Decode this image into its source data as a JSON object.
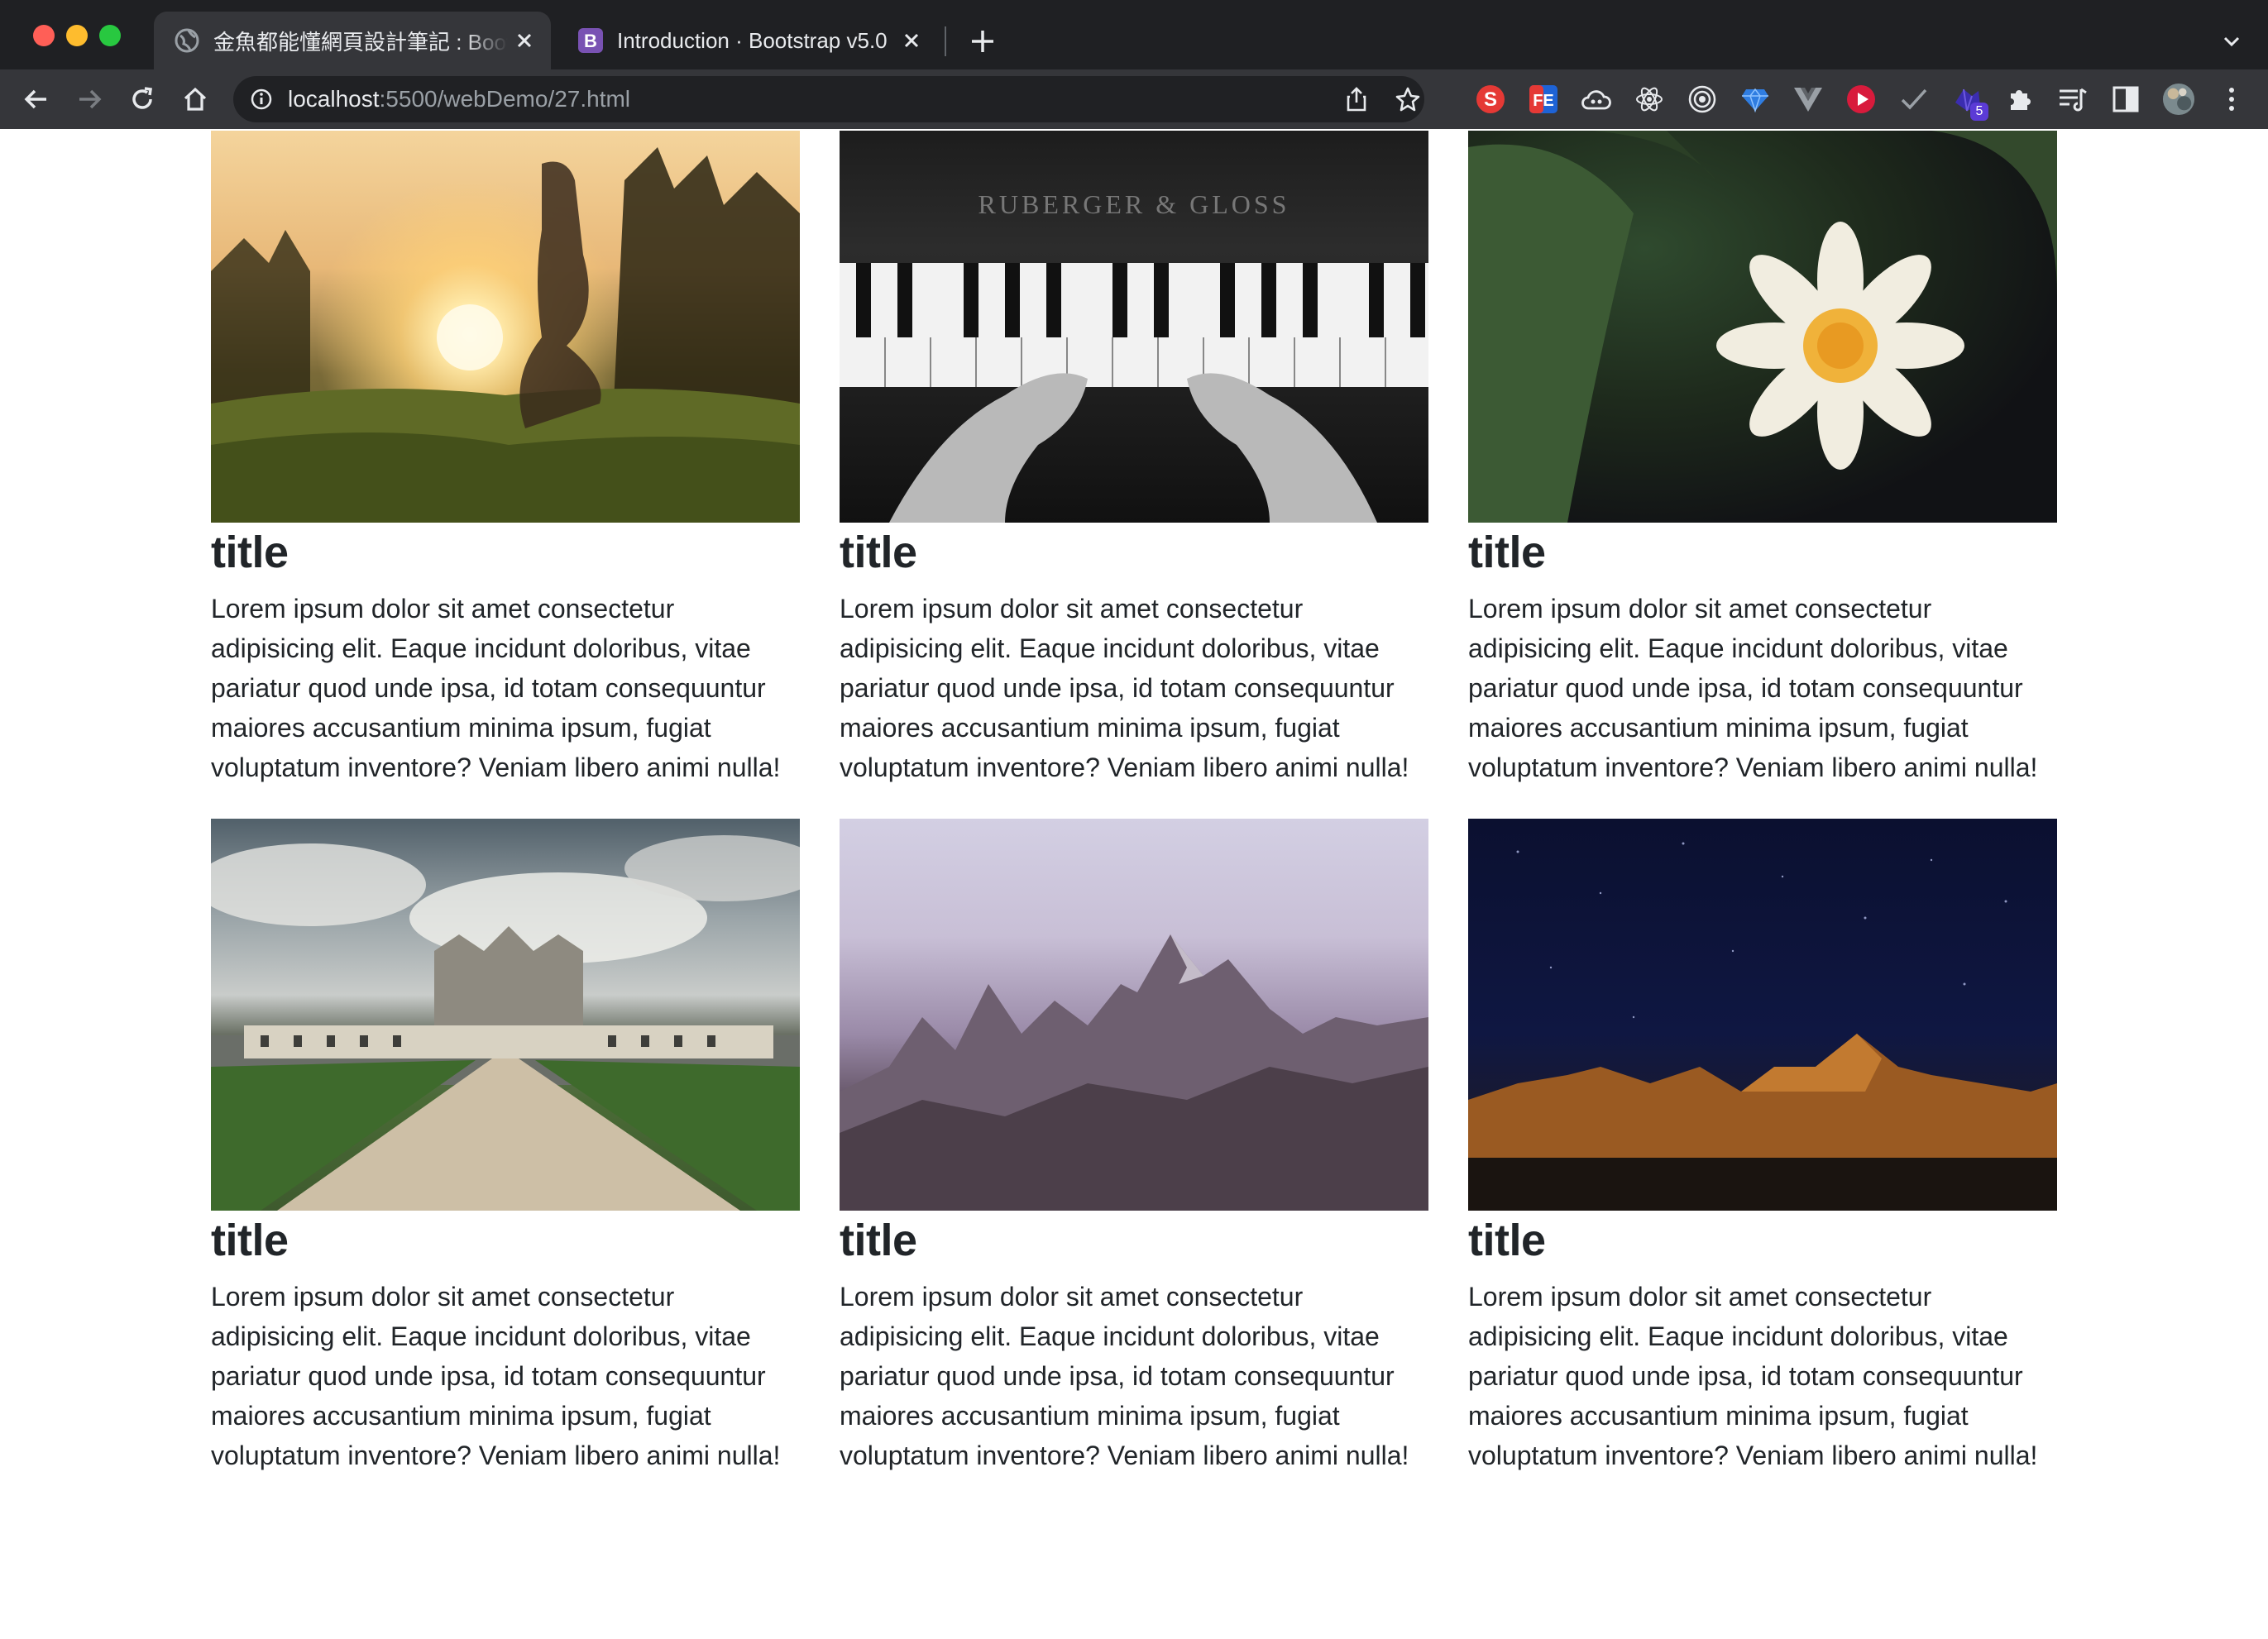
{
  "browser": {
    "tabs": [
      {
        "title": "金魚都能懂網頁設計筆記 : Bootstr",
        "active": true,
        "favicon": "globe-icon"
      },
      {
        "title": "Introduction · Bootstrap v5.0",
        "active": false,
        "favicon": "bootstrap-icon",
        "favicon_color": "#7952b3"
      }
    ],
    "url_host": "localhost",
    "url_path": ":5500/webDemo/27.html",
    "extensions": [
      "s-icon",
      "fe-icon",
      "cloud-icon",
      "react-icon",
      "target-icon",
      "gem-icon",
      "vue-icon",
      "youtube-icon",
      "check-icon",
      "extension-badge-icon",
      "puzzle-icon",
      "reading-list-icon",
      "sidepanel-icon",
      "avatar"
    ],
    "extension_badge_count": "5"
  },
  "page": {
    "cards": [
      {
        "title": "title",
        "image": "girl-sunset-photo",
        "text": "Lorem ipsum dolor sit amet consectetur adipisicing elit. Eaque incidunt doloribus, vitae pariatur quod unde ipsa, id totam consequuntur maiores accusantium minima ipsum, fugiat voluptatum inventore? Veniam libero animi nulla!"
      },
      {
        "title": "title",
        "image": "piano-hands-photo",
        "text": "Lorem ipsum dolor sit amet consectetur adipisicing elit. Eaque incidunt doloribus, vitae pariatur quod unde ipsa, id totam consequuntur maiores accusantium minima ipsum, fugiat voluptatum inventore? Veniam libero animi nulla!"
      },
      {
        "title": "title",
        "image": "water-lily-photo",
        "text": "Lorem ipsum dolor sit amet consectetur adipisicing elit. Eaque incidunt doloribus, vitae pariatur quod unde ipsa, id totam consequuntur maiores accusantium minima ipsum, fugiat voluptatum inventore? Veniam libero animi nulla!"
      },
      {
        "title": "title",
        "image": "castle-road-photo",
        "text": "Lorem ipsum dolor sit amet consectetur adipisicing elit. Eaque incidunt doloribus, vitae pariatur quod unde ipsa, id totam consequuntur maiores accusantium minima ipsum, fugiat voluptatum inventore? Veniam libero animi nulla!"
      },
      {
        "title": "title",
        "image": "mountain-peaks-photo",
        "text": "Lorem ipsum dolor sit amet consectetur adipisicing elit. Eaque incidunt doloribus, vitae pariatur quod unde ipsa, id totam consequuntur maiores accusantium minima ipsum, fugiat voluptatum inventore? Veniam libero animi nulla!"
      },
      {
        "title": "title",
        "image": "night-desert-photo",
        "text": "Lorem ipsum dolor sit amet consectetur adipisicing elit. Eaque incidunt doloribus, vitae pariatur quod unde ipsa, id totam consequuntur maiores accusantium minima ipsum, fugiat voluptatum inventore? Veniam libero animi nulla!"
      }
    ]
  }
}
